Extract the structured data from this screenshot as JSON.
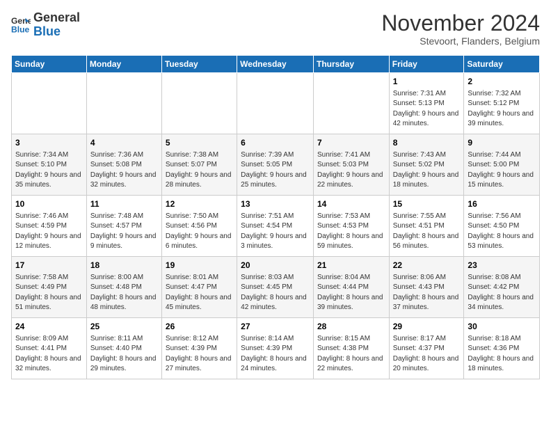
{
  "logo": {
    "line1": "General",
    "line2": "Blue"
  },
  "title": "November 2024",
  "subtitle": "Stevoort, Flanders, Belgium",
  "weekdays": [
    "Sunday",
    "Monday",
    "Tuesday",
    "Wednesday",
    "Thursday",
    "Friday",
    "Saturday"
  ],
  "weeks": [
    [
      {
        "day": "",
        "info": ""
      },
      {
        "day": "",
        "info": ""
      },
      {
        "day": "",
        "info": ""
      },
      {
        "day": "",
        "info": ""
      },
      {
        "day": "",
        "info": ""
      },
      {
        "day": "1",
        "info": "Sunrise: 7:31 AM\nSunset: 5:13 PM\nDaylight: 9 hours and 42 minutes."
      },
      {
        "day": "2",
        "info": "Sunrise: 7:32 AM\nSunset: 5:12 PM\nDaylight: 9 hours and 39 minutes."
      }
    ],
    [
      {
        "day": "3",
        "info": "Sunrise: 7:34 AM\nSunset: 5:10 PM\nDaylight: 9 hours and 35 minutes."
      },
      {
        "day": "4",
        "info": "Sunrise: 7:36 AM\nSunset: 5:08 PM\nDaylight: 9 hours and 32 minutes."
      },
      {
        "day": "5",
        "info": "Sunrise: 7:38 AM\nSunset: 5:07 PM\nDaylight: 9 hours and 28 minutes."
      },
      {
        "day": "6",
        "info": "Sunrise: 7:39 AM\nSunset: 5:05 PM\nDaylight: 9 hours and 25 minutes."
      },
      {
        "day": "7",
        "info": "Sunrise: 7:41 AM\nSunset: 5:03 PM\nDaylight: 9 hours and 22 minutes."
      },
      {
        "day": "8",
        "info": "Sunrise: 7:43 AM\nSunset: 5:02 PM\nDaylight: 9 hours and 18 minutes."
      },
      {
        "day": "9",
        "info": "Sunrise: 7:44 AM\nSunset: 5:00 PM\nDaylight: 9 hours and 15 minutes."
      }
    ],
    [
      {
        "day": "10",
        "info": "Sunrise: 7:46 AM\nSunset: 4:59 PM\nDaylight: 9 hours and 12 minutes."
      },
      {
        "day": "11",
        "info": "Sunrise: 7:48 AM\nSunset: 4:57 PM\nDaylight: 9 hours and 9 minutes."
      },
      {
        "day": "12",
        "info": "Sunrise: 7:50 AM\nSunset: 4:56 PM\nDaylight: 9 hours and 6 minutes."
      },
      {
        "day": "13",
        "info": "Sunrise: 7:51 AM\nSunset: 4:54 PM\nDaylight: 9 hours and 3 minutes."
      },
      {
        "day": "14",
        "info": "Sunrise: 7:53 AM\nSunset: 4:53 PM\nDaylight: 8 hours and 59 minutes."
      },
      {
        "day": "15",
        "info": "Sunrise: 7:55 AM\nSunset: 4:51 PM\nDaylight: 8 hours and 56 minutes."
      },
      {
        "day": "16",
        "info": "Sunrise: 7:56 AM\nSunset: 4:50 PM\nDaylight: 8 hours and 53 minutes."
      }
    ],
    [
      {
        "day": "17",
        "info": "Sunrise: 7:58 AM\nSunset: 4:49 PM\nDaylight: 8 hours and 51 minutes."
      },
      {
        "day": "18",
        "info": "Sunrise: 8:00 AM\nSunset: 4:48 PM\nDaylight: 8 hours and 48 minutes."
      },
      {
        "day": "19",
        "info": "Sunrise: 8:01 AM\nSunset: 4:47 PM\nDaylight: 8 hours and 45 minutes."
      },
      {
        "day": "20",
        "info": "Sunrise: 8:03 AM\nSunset: 4:45 PM\nDaylight: 8 hours and 42 minutes."
      },
      {
        "day": "21",
        "info": "Sunrise: 8:04 AM\nSunset: 4:44 PM\nDaylight: 8 hours and 39 minutes."
      },
      {
        "day": "22",
        "info": "Sunrise: 8:06 AM\nSunset: 4:43 PM\nDaylight: 8 hours and 37 minutes."
      },
      {
        "day": "23",
        "info": "Sunrise: 8:08 AM\nSunset: 4:42 PM\nDaylight: 8 hours and 34 minutes."
      }
    ],
    [
      {
        "day": "24",
        "info": "Sunrise: 8:09 AM\nSunset: 4:41 PM\nDaylight: 8 hours and 32 minutes."
      },
      {
        "day": "25",
        "info": "Sunrise: 8:11 AM\nSunset: 4:40 PM\nDaylight: 8 hours and 29 minutes."
      },
      {
        "day": "26",
        "info": "Sunrise: 8:12 AM\nSunset: 4:39 PM\nDaylight: 8 hours and 27 minutes."
      },
      {
        "day": "27",
        "info": "Sunrise: 8:14 AM\nSunset: 4:39 PM\nDaylight: 8 hours and 24 minutes."
      },
      {
        "day": "28",
        "info": "Sunrise: 8:15 AM\nSunset: 4:38 PM\nDaylight: 8 hours and 22 minutes."
      },
      {
        "day": "29",
        "info": "Sunrise: 8:17 AM\nSunset: 4:37 PM\nDaylight: 8 hours and 20 minutes."
      },
      {
        "day": "30",
        "info": "Sunrise: 8:18 AM\nSunset: 4:36 PM\nDaylight: 8 hours and 18 minutes."
      }
    ]
  ]
}
